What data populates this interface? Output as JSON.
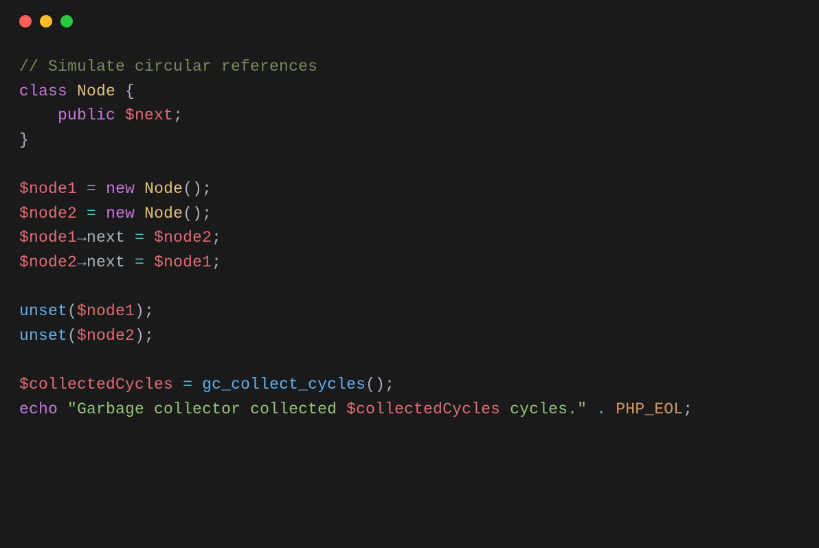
{
  "code": {
    "tokens": [
      {
        "t": "// Simulate circular references",
        "c": "comment"
      },
      {
        "t": "\n",
        "c": "default"
      },
      {
        "t": "class",
        "c": "keyword"
      },
      {
        "t": " ",
        "c": "default"
      },
      {
        "t": "Node",
        "c": "classname"
      },
      {
        "t": " {",
        "c": "punc"
      },
      {
        "t": "\n",
        "c": "default"
      },
      {
        "t": "    ",
        "c": "default"
      },
      {
        "t": "public",
        "c": "keyword"
      },
      {
        "t": " ",
        "c": "default"
      },
      {
        "t": "$next",
        "c": "var"
      },
      {
        "t": ";",
        "c": "punc"
      },
      {
        "t": "\n",
        "c": "default"
      },
      {
        "t": "}",
        "c": "punc"
      },
      {
        "t": "\n",
        "c": "default"
      },
      {
        "t": "\n",
        "c": "default"
      },
      {
        "t": "$node1",
        "c": "var"
      },
      {
        "t": " ",
        "c": "default"
      },
      {
        "t": "=",
        "c": "op"
      },
      {
        "t": " ",
        "c": "default"
      },
      {
        "t": "new",
        "c": "keyword"
      },
      {
        "t": " ",
        "c": "default"
      },
      {
        "t": "Node",
        "c": "classname"
      },
      {
        "t": "();",
        "c": "punc"
      },
      {
        "t": "\n",
        "c": "default"
      },
      {
        "t": "$node2",
        "c": "var"
      },
      {
        "t": " ",
        "c": "default"
      },
      {
        "t": "=",
        "c": "op"
      },
      {
        "t": " ",
        "c": "default"
      },
      {
        "t": "new",
        "c": "keyword"
      },
      {
        "t": " ",
        "c": "default"
      },
      {
        "t": "Node",
        "c": "classname"
      },
      {
        "t": "();",
        "c": "punc"
      },
      {
        "t": "\n",
        "c": "default"
      },
      {
        "t": "$node1",
        "c": "var"
      },
      {
        "t": "→",
        "c": "default"
      },
      {
        "t": "next",
        "c": "default"
      },
      {
        "t": " ",
        "c": "default"
      },
      {
        "t": "=",
        "c": "op"
      },
      {
        "t": " ",
        "c": "default"
      },
      {
        "t": "$node2",
        "c": "var"
      },
      {
        "t": ";",
        "c": "punc"
      },
      {
        "t": "\n",
        "c": "default"
      },
      {
        "t": "$node2",
        "c": "var"
      },
      {
        "t": "→",
        "c": "default"
      },
      {
        "t": "next",
        "c": "default"
      },
      {
        "t": " ",
        "c": "default"
      },
      {
        "t": "=",
        "c": "op"
      },
      {
        "t": " ",
        "c": "default"
      },
      {
        "t": "$node1",
        "c": "var"
      },
      {
        "t": ";",
        "c": "punc"
      },
      {
        "t": "\n",
        "c": "default"
      },
      {
        "t": "\n",
        "c": "default"
      },
      {
        "t": "unset",
        "c": "func"
      },
      {
        "t": "(",
        "c": "punc"
      },
      {
        "t": "$node1",
        "c": "var"
      },
      {
        "t": ");",
        "c": "punc"
      },
      {
        "t": "\n",
        "c": "default"
      },
      {
        "t": "unset",
        "c": "func"
      },
      {
        "t": "(",
        "c": "punc"
      },
      {
        "t": "$node2",
        "c": "var"
      },
      {
        "t": ");",
        "c": "punc"
      },
      {
        "t": "\n",
        "c": "default"
      },
      {
        "t": "\n",
        "c": "default"
      },
      {
        "t": "$collectedCycles",
        "c": "var"
      },
      {
        "t": " ",
        "c": "default"
      },
      {
        "t": "=",
        "c": "op"
      },
      {
        "t": " ",
        "c": "default"
      },
      {
        "t": "gc_collect_cycles",
        "c": "func"
      },
      {
        "t": "();",
        "c": "punc"
      },
      {
        "t": "\n",
        "c": "default"
      },
      {
        "t": "echo",
        "c": "keyword"
      },
      {
        "t": " ",
        "c": "default"
      },
      {
        "t": "\"Garbage collector collected ",
        "c": "string"
      },
      {
        "t": "$collectedCycles",
        "c": "var"
      },
      {
        "t": " cycles.\"",
        "c": "string"
      },
      {
        "t": " ",
        "c": "default"
      },
      {
        "t": ".",
        "c": "op"
      },
      {
        "t": " ",
        "c": "default"
      },
      {
        "t": "PHP_EOL",
        "c": "const"
      },
      {
        "t": ";",
        "c": "punc"
      }
    ]
  },
  "titlebar": {
    "buttons": [
      "close",
      "minimize",
      "zoom"
    ]
  }
}
